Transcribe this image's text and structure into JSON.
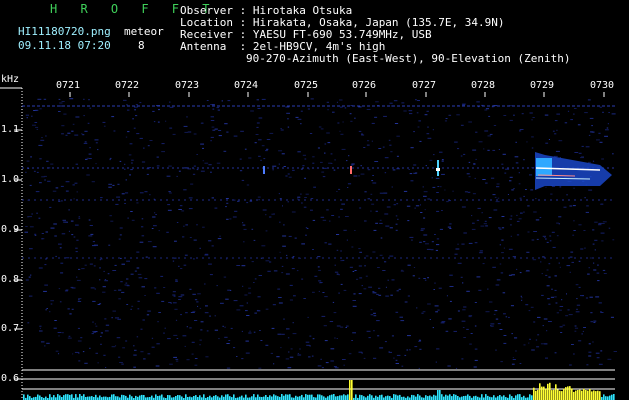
{
  "header": {
    "brand": "H R O F F T",
    "filename": "HI11180720.png",
    "timestamp": "09.11.18 07:20",
    "meteor_label": "meteor",
    "meteor_count": "8"
  },
  "info": [
    {
      "key": "Observer ",
      "sep": ": ",
      "value": "Hirotaka Otsuka"
    },
    {
      "key": "Location ",
      "sep": ": ",
      "value": "Hirakata, Osaka, Japan (135.7E, 34.9N)"
    },
    {
      "key": "Receiver ",
      "sep": ": ",
      "value": "YAESU FT-690 53.749MHz, USB"
    },
    {
      "key": "Antenna  ",
      "sep": ": ",
      "value": "2el-HB9CV, 4m's high"
    },
    {
      "key": "",
      "sep": "",
      "value": "90-270-Azimuth (East-West), 90-Elevation (Zenith)"
    }
  ],
  "axis": {
    "unit": "kHz",
    "time_ticks": [
      "0721",
      "0722",
      "0723",
      "0724",
      "0725",
      "0726",
      "0727",
      "0728",
      "0729",
      "0730"
    ],
    "freq_ticks": [
      "1.1",
      "1.0",
      "0.9",
      "0.8",
      "0.7",
      "0.6"
    ]
  },
  "colors": {
    "background": "#000000",
    "brand": "#3fd05a",
    "noise": "#1e2a8a",
    "signal_bright": "#ffffff",
    "level_cyan": "#2ee6ff",
    "level_yellow": "#ffff33"
  }
}
